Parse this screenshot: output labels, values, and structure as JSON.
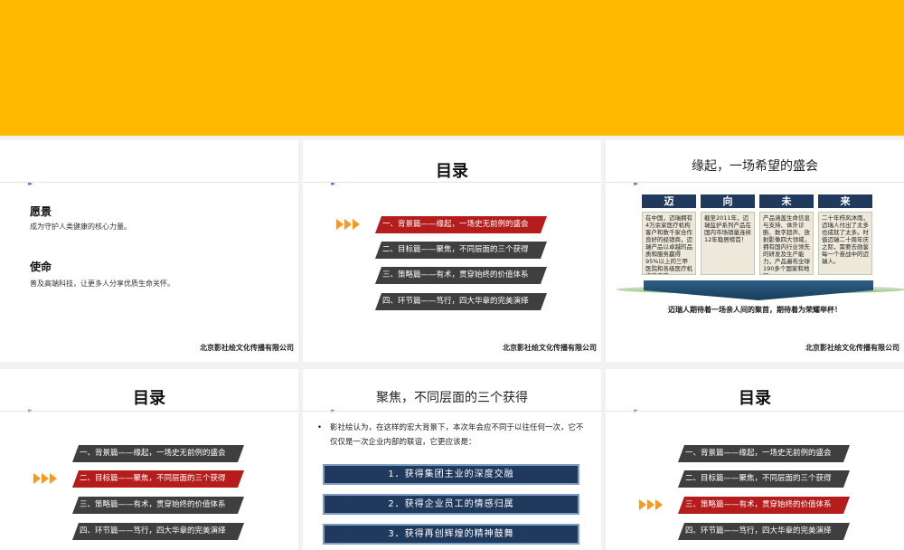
{
  "footer": "北京影社绘文化传播有限公司",
  "slide1": {
    "vision_title": "愿景",
    "vision_text": "成为守护人类健康的核心力量。",
    "mission_title": "使命",
    "mission_text": "普及高端科技，让更多人分享优质生命关怀。"
  },
  "toc": {
    "title": "目录",
    "items": [
      "一、背景篇——缘起，一场史无前例的盛会",
      "二、目标篇——聚焦，不同层面的三个获得",
      "三、策略篇——有术，贯穿始终的价值体系",
      "四、环节篇——笃行，四大华章的完美演绎"
    ]
  },
  "slide3": {
    "title": "缘起，一场希望的盛会",
    "columns": [
      {
        "head": "迈",
        "text": "在中国，迈瑞拥有4万余家医疗机构客户和数千家合作良好的经销商，迈瑞产品以卓越的品质和服务赢得95%以上的三甲医院和各级医疗机构的青睐"
      },
      {
        "head": "向",
        "text": "截至2011年，迈瑞监护系列产品在国内市场销量连续12年稳居榜首！"
      },
      {
        "head": "未",
        "text": "产品涵盖生命信息与支持、体外诊断、数字超声、放射影像四大领域，拥有国内行业领先的研发及生产能力，产品遍布全球190多个国家和地区。"
      },
      {
        "head": "来",
        "text": "二十年栉风沐雨，迈瑞人付出了太多也成就了太多。时值迈瑞二十周年庆之际，需要去勋鉴每一个奋战中的迈瑞人。"
      }
    ],
    "caption": "迈瑞人期待着一场亲人间的聚首，期待着为荣耀举杯！"
  },
  "slide5": {
    "title": "聚焦，不同层面的三个获得",
    "bullet": "影社绘认为，在这样的宏大背景下，本次年会应不同于以往任何一次，它不仅仅是一次企业内部的联谊，它更应该是：",
    "bars": [
      "1．获得集团主业的深度交融",
      "2．获得企业员工的情感归属",
      "3．获得再创辉煌的精神鼓舞"
    ]
  },
  "colors": {
    "banner": "#ffba00",
    "toc_active": "#b51c1c",
    "toc_inactive": "#3f3f3f",
    "navy": "#1f3a5c",
    "arrow": "#f39a1f"
  },
  "icons": {
    "marker": "double-triangle-marker",
    "pointer": "triple-arrow-pointer"
  }
}
